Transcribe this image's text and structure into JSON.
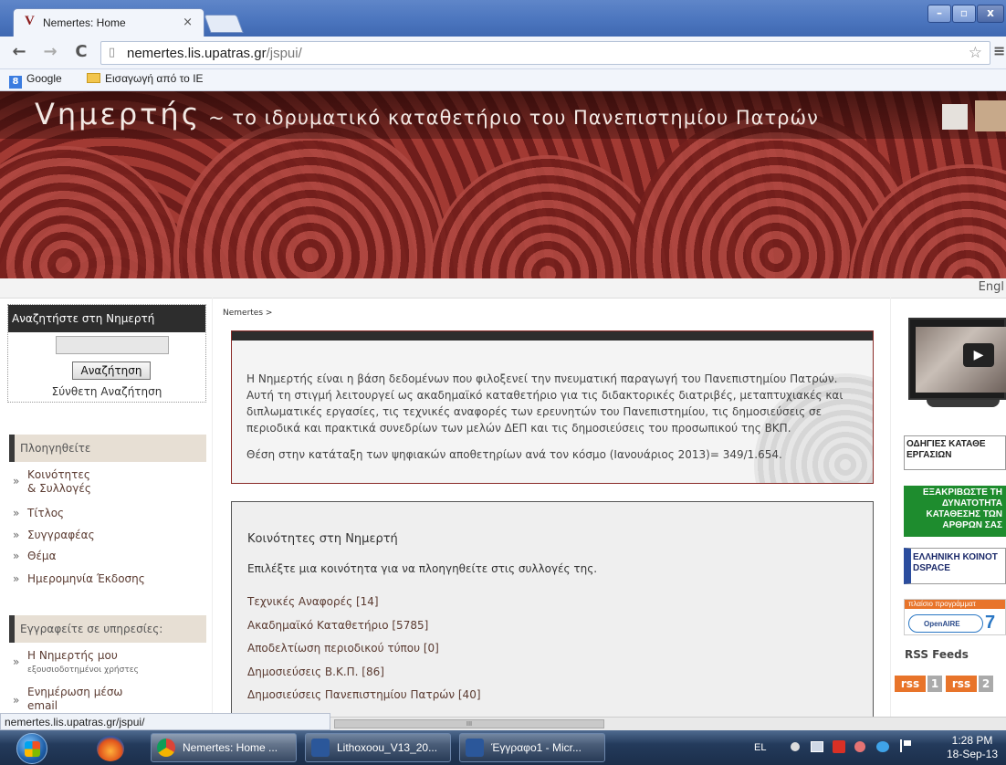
{
  "browser": {
    "tab_favicon": "V",
    "tab_title": "Nemertes: Home",
    "tab_close": "×",
    "win_minimize": "–",
    "win_maximize": "▫",
    "win_close": "x",
    "back": "←",
    "forward": "→",
    "reload": "C",
    "url_host": "nemertes.lis.upatras.gr",
    "url_path": "/jspui/",
    "star": "☆",
    "menu": "≡",
    "bookmarks": [
      {
        "label": "Google",
        "icon": "google-icon"
      },
      {
        "label": "Εισαγωγή από το IE",
        "icon": "folder-icon"
      }
    ],
    "status_url": "nemertes.lis.upatras.gr/jspui/",
    "scroll_grip": "III"
  },
  "banner": {
    "logo_letter": "V",
    "name": "ημερτής",
    "tagline": "~ το ιδρυματικό καταθετήριο του Πανεπιστημίου Πατρών",
    "language_link": "Engl"
  },
  "sidebar": {
    "search_header": "Αναζητήστε στη Νημερτή",
    "search_value": "",
    "search_button": "Αναζήτηση",
    "advanced_search": "Σύνθετη Αναζήτηση",
    "browse_header": "Πλοηγηθείτε",
    "browse_items": [
      {
        "line1": "Κοινότητες",
        "line2": "& Συλλογές"
      },
      {
        "line1": "Τίτλος"
      },
      {
        "line1": "Συγγραφέας"
      },
      {
        "line1": "Θέμα"
      },
      {
        "line1": "Ημερομηνία Έκδοσης"
      }
    ],
    "services_header": "Εγγραφείτε σε υπηρεσίες:",
    "services_items": [
      {
        "line1": "Η Νημερτής μου",
        "line2": "εξουσιοδοτημένοι χρήστες"
      },
      {
        "line1": "Ενημέρωση μέσω",
        "line2": "email"
      }
    ],
    "arrow": "»"
  },
  "main": {
    "breadcrumb": "Nemertes >",
    "intro_text": "Η Νημερτής είναι η βάση δεδομένων που φιλοξενεί την πνευματική παραγωγή του Πανεπιστημίου Πατρών. Αυτή τη στιγμή λειτουργεί ως ακαδημαϊκό καταθετήριο για τις διδακτορικές διατριβές, μεταπτυχιακές και διπλωματικές εργασίες, τις τεχνικές αναφορές των ερευνητών του Πανεπιστημίου, τις δημοσιεύσεις σε περιοδικά και πρακτικά συνεδρίων των μελών ΔΕΠ και τις δημοσιεύσεις του προσωπικού της ΒΚΠ.",
    "ranking_text": "Θέση στην κατάταξη των ψηφιακών αποθετηρίων ανά τον κόσμο (Ιανουάριος 2013)= 349/1.654.",
    "communities_title": "Κοινότητες στη Νημερτή",
    "communities_subtitle": "Επιλέξτε μια κοινότητα για να πλοηγηθείτε στις συλλογές της.",
    "communities": [
      "Τεχνικές Αναφορές [14]",
      "Ακαδημαϊκό Καταθετήριο [5785]",
      "Αποδελτίωση περιοδικού τύπου [0]",
      "Δημοσιεύσεις Β.Κ.Π. [86]",
      "Δημοσιεύσεις Πανεπιστημίου Πατρών [40]"
    ]
  },
  "right": {
    "video_play": "▶",
    "promo1": "ΟΔΗΓΙΕΣ ΚΑΤΑΘΕ ΕΡΓΑΣΙΩΝ",
    "promo2": "ΕΞΑΚΡΙΒΩΣΤΕ ΤΗ ΔΥΝΑΤΟΤΗΤΑ ΚΑΤΑΘΕΣΗΣ ΤΩΝ ΑΡΘΡΩΝ ΣΑΣ",
    "promo3": "ΕΛΛΗΝΙΚΗ ΚΟΙΝΟΤ DSPACE",
    "promo4_strip": "πλαίσιο προγράμματ",
    "promo4_logo": "OpenAIRE",
    "promo4_mark": "7",
    "rss_title": "RSS Feeds",
    "rss": [
      {
        "tag": "rss",
        "num": "1"
      },
      {
        "tag": "rss",
        "num": "2"
      }
    ]
  },
  "taskbar": {
    "tasks": [
      {
        "label": "Nemertes: Home ...",
        "icon": "chrome-icon"
      },
      {
        "label": "Lithoxoou_V13_20...",
        "icon": "word-icon"
      },
      {
        "label": "Έγγραφο1 - Micr...",
        "icon": "word-icon"
      }
    ],
    "language": "EL",
    "time": "1:28 PM",
    "date": "18-Sep-13"
  },
  "colors": {
    "banner_red": "#8c2b27",
    "dark_header": "#2d2d2d",
    "sidebar_header": "#e7dfd4",
    "link_brown": "#5a3a30",
    "green_promo": "#1e8c2e",
    "rss_orange": "#e8742a"
  }
}
